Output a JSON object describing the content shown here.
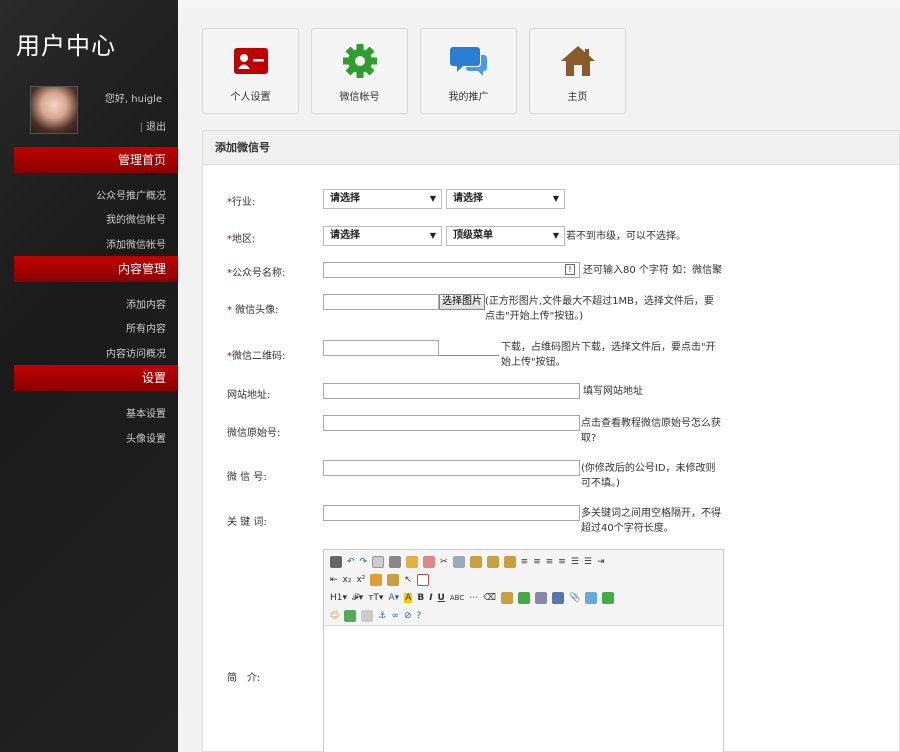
{
  "sidebar": {
    "title": "用户中心",
    "greeting": "您好, huigle",
    "logout": "退出",
    "sections": [
      {
        "label": "管理首页",
        "items": [
          "公众号推广概况",
          "我的微信帐号",
          "添加微信帐号"
        ]
      },
      {
        "label": "内容管理",
        "items": [
          "添加内容",
          "所有内容",
          "内容访问概况"
        ]
      },
      {
        "label": "设置",
        "items": [
          "基本设置",
          "头像设置"
        ]
      }
    ]
  },
  "tiles": [
    {
      "label": "个人设置",
      "icon": "id-card-icon",
      "color": "#c00000"
    },
    {
      "label": "微信帐号",
      "icon": "gear-icon",
      "color": "#2e9e2e"
    },
    {
      "label": "我的推广",
      "icon": "chat-bubbles-icon",
      "color": "#2a7fd4"
    },
    {
      "label": "主页",
      "icon": "home-icon",
      "color": "#8b5a2b"
    }
  ],
  "panel": {
    "title": "添加微信号",
    "fields": {
      "industry": {
        "label": "行业:",
        "select1": "请选择",
        "select2": "请选择"
      },
      "region": {
        "label": "地区:",
        "select1": "请选择",
        "select2": "顶级菜单",
        "hint": "若不到市级，可以不选择。"
      },
      "account_name": {
        "label": "公众号名称:",
        "hint": "还可输入80 个字符 如：微信聚"
      },
      "avatar": {
        "label": " 微信头像:",
        "button": "选择图片",
        "hint": "(正方形图片,文件最大不超过1MB，选择文件后，要点击\"开始上传\"按钮。)"
      },
      "qrcode": {
        "label": "微信二维码:",
        "hint": "下载，占维码图片下载，选择文件后，要点击\"开始上传\"按钮。"
      },
      "website": {
        "label": "网站地址:",
        "hint": "填写网站地址"
      },
      "original_id": {
        "label": "微信原始号:",
        "hint": "点击查看教程微信原始号怎么获取?"
      },
      "wechat_id": {
        "label": "微 信 号:",
        "hint": "(你修改后的公号ID，未修改则可不填。)"
      },
      "keywords": {
        "label": "关 键 词:",
        "hint": "多关键词之间用空格隔开，不得超过40个字符长度。"
      },
      "intro": {
        "label": "简　介:"
      }
    }
  }
}
